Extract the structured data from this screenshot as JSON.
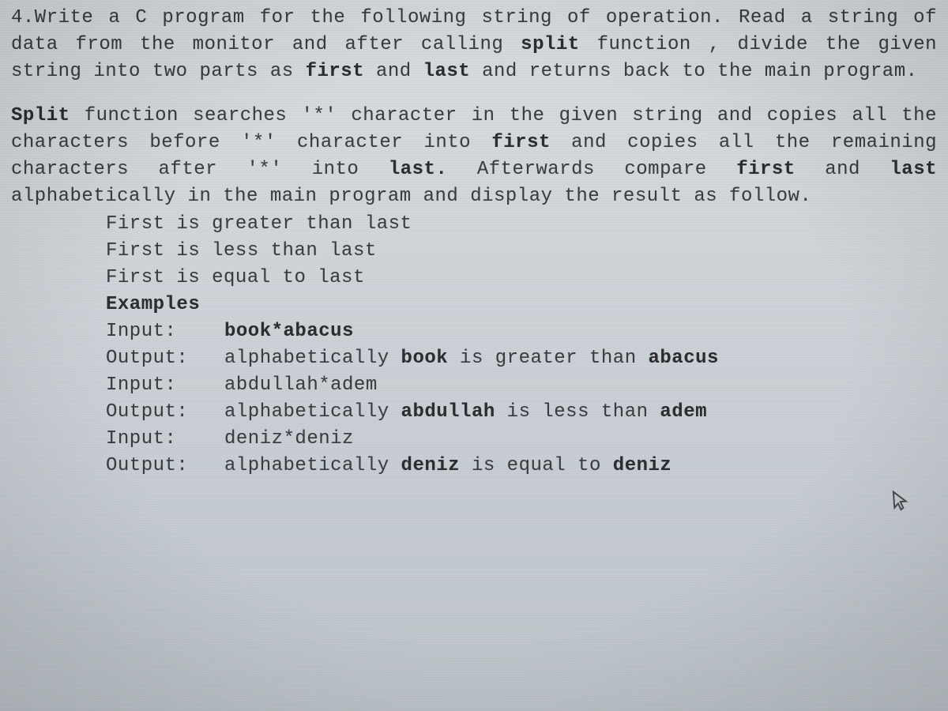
{
  "p1": {
    "lead": "4.Write a C program for the following string of operation. Read a string of data from the monitor and after calling ",
    "split": "split",
    "mid": " function , divide the given string into two parts as ",
    "first": "first",
    "and": " and ",
    "last": "last",
    "tail": " and returns back to the main program."
  },
  "p2": {
    "a": "Split",
    "b": " function searches '*' character in the given string and copies all the characters before '*' character into ",
    "first": "first",
    "c": " and copies all the remaining characters after '*' into ",
    "last": "last.",
    "d": " Afterwards compare ",
    "first2": "first",
    "e": " and ",
    "last2": "last",
    "f": " alphabetically in the main program and display the result as follow."
  },
  "lines": {
    "l1": "First is greater than last",
    "l2": "First is less than last",
    "l3": "First is equal to last",
    "examples": "Examples"
  },
  "ex": [
    {
      "inLabel": "Input:",
      "outLabel": "Output:",
      "inVal": {
        "b": "book*abacus"
      },
      "outVal": {
        "a": "alphabetically ",
        "b1": "book",
        "m": " is greater than ",
        "b2": "abacus"
      }
    },
    {
      "inLabel": "Input:",
      "outLabel": "Output:",
      "inVal": {
        "t": "abdullah*adem"
      },
      "outVal": {
        "a": "alphabetically ",
        "b1": "abdullah",
        "m": " is less than ",
        "b2": "adem"
      }
    },
    {
      "inLabel": "Input:",
      "outLabel": "Output:",
      "inVal": {
        "t": "deniz*deniz"
      },
      "outVal": {
        "a": "alphabetically ",
        "b1": "deniz",
        "m": " is equal to ",
        "b2": "deniz"
      }
    }
  ]
}
